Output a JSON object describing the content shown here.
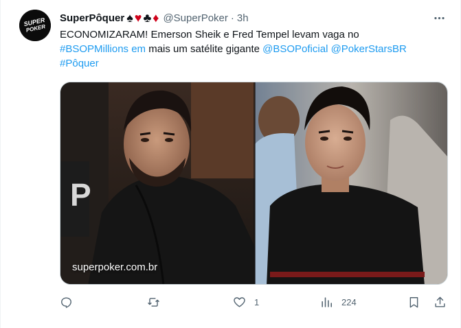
{
  "account": {
    "display_name": "SuperPôquer",
    "handle": "@SuperPoker",
    "separator": "·",
    "time": "3h",
    "suits": [
      "♠",
      "♥",
      "♣",
      "♦"
    ]
  },
  "avatar": {
    "logo_line1": "SUPER",
    "logo_line2": "POKER"
  },
  "tweet": {
    "line1": "ECONOMIZARAM! Emerson Sheik e Fred Tempel levam vaga no",
    "hashtag_bsop": "#BSOPMillions em",
    "line2_rest": " mais um satélite gigante  ",
    "mention_bsop": "@BSOPoficial",
    "mention_ps": "@PokerStarsBR",
    "hashtag_poquer": "#Pôquer"
  },
  "media": {
    "watermark": "superpoker.com.br"
  },
  "actions": {
    "reply_count": "",
    "retweet_count": "",
    "like_count": "1",
    "views_count": "224"
  },
  "colors": {
    "link": "#1d9bf0",
    "muted": "#536471",
    "text": "#0f1419"
  },
  "icons": [
    "more-icon",
    "reply-icon",
    "retweet-icon",
    "like-icon",
    "views-icon",
    "bookmark-icon",
    "share-icon"
  ]
}
